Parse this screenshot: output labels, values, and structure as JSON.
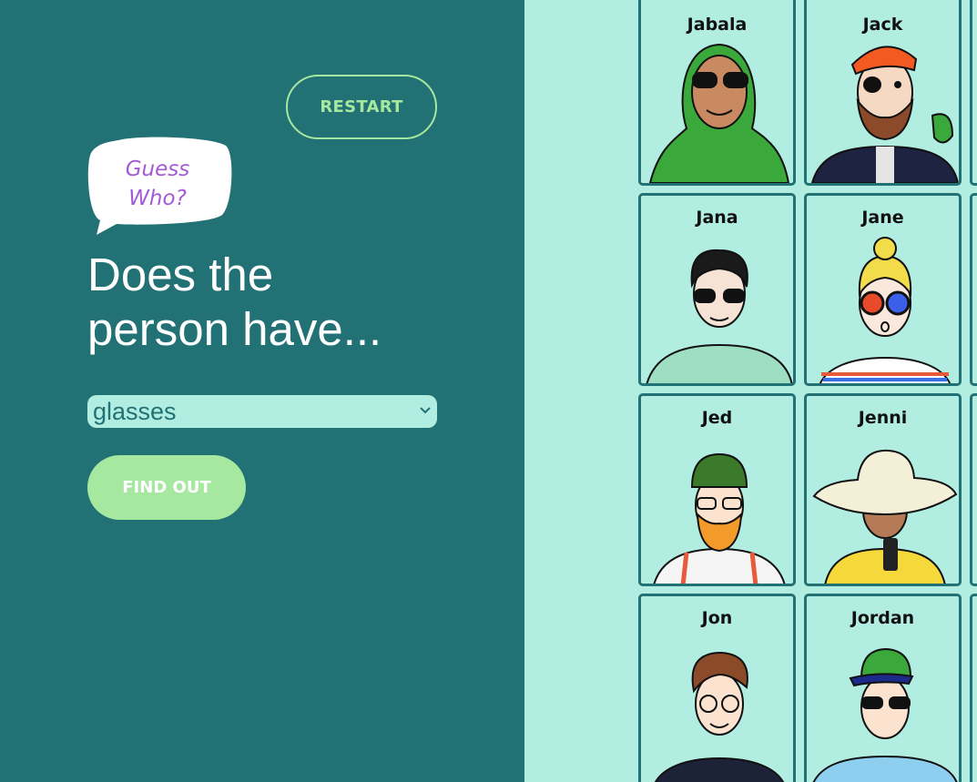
{
  "header": {
    "restart_label": "RESTART",
    "logo_line1": "Guess",
    "logo_line2": "Who?",
    "question_line1": "Does the",
    "question_line2": "person have..."
  },
  "controls": {
    "select_value": "glasses",
    "find_out_label": "FIND OUT"
  },
  "board": {
    "cards": [
      {
        "name": "Jabala"
      },
      {
        "name": "Jack"
      },
      {
        "name": "Jana"
      },
      {
        "name": "Jane"
      },
      {
        "name": "Jed"
      },
      {
        "name": "Jenni"
      },
      {
        "name": "Jon"
      },
      {
        "name": "Jordan"
      }
    ]
  },
  "colors": {
    "sidebar_bg": "#227175",
    "board_bg": "#b2ede2",
    "accent_green": "#a7e8a0",
    "logo_purple": "#a45ad6",
    "card_border": "#227175"
  }
}
